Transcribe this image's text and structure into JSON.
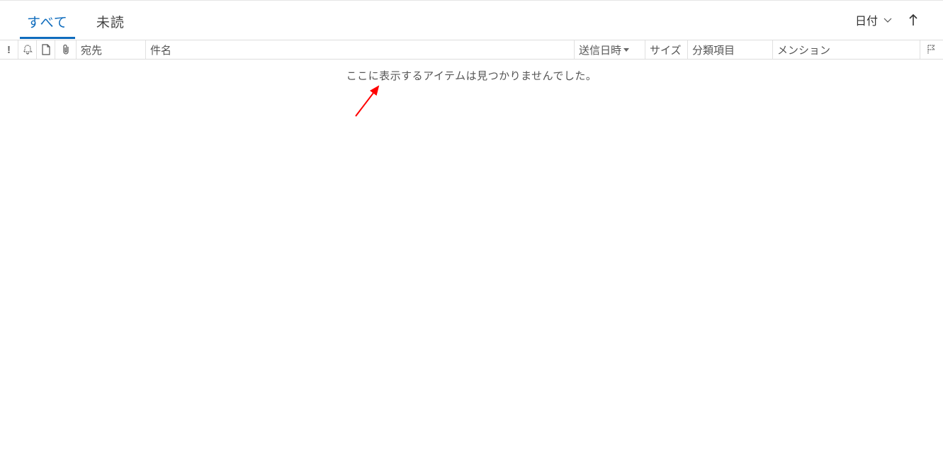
{
  "tabs": {
    "all": "すべて",
    "unread": "未読"
  },
  "sort": {
    "label": "日付"
  },
  "columns": {
    "importance": "!",
    "reminder": "reminder-icon",
    "type": "item-type-icon",
    "attachment": "attachment-icon",
    "to": "宛先",
    "subject": "件名",
    "sent": "送信日時",
    "size": "サイズ",
    "categories": "分類項目",
    "mention": "メンション",
    "flag": "flag-icon"
  },
  "body": {
    "empty_message": "ここに表示するアイテムは見つかりませんでした。"
  }
}
